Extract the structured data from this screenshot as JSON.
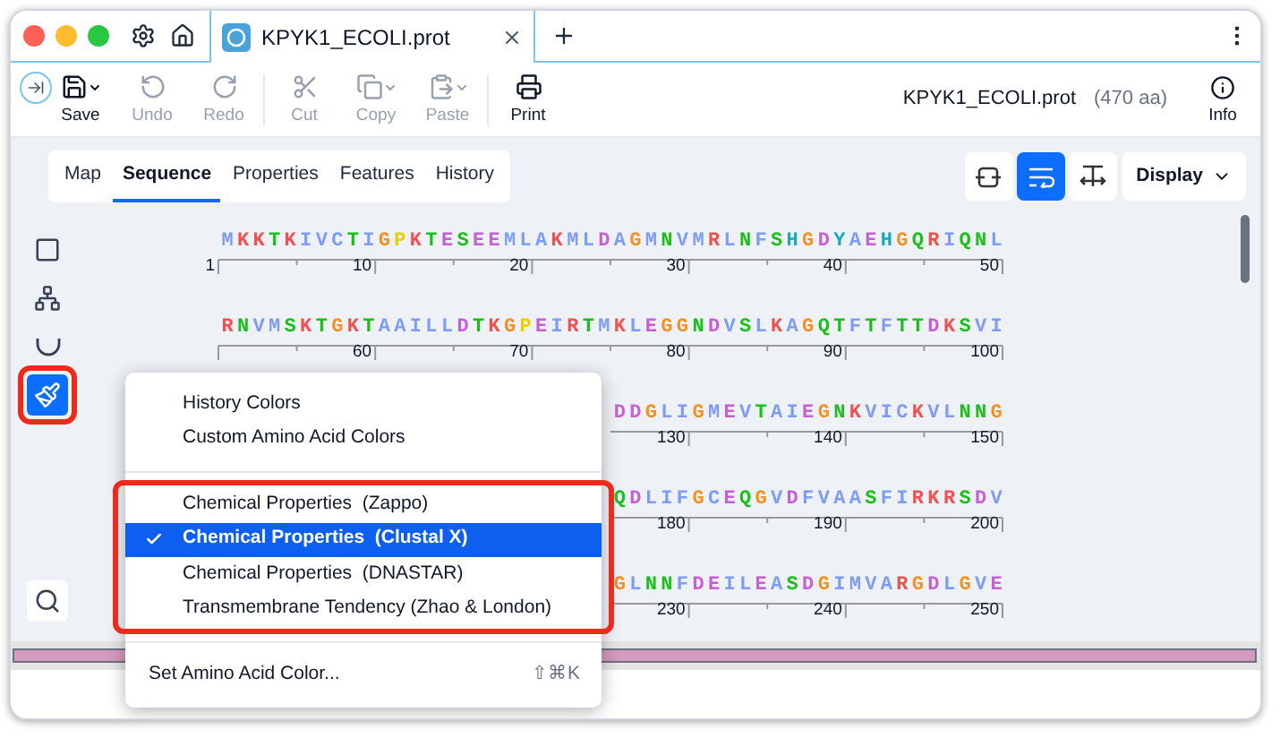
{
  "window": {
    "tab_title": "KPYK1_ECOLI.prot"
  },
  "toolbar": {
    "groups": [
      [
        {
          "label": "Save",
          "kind": "save",
          "disabled": false,
          "has_menu": true
        },
        {
          "label": "Undo",
          "kind": "undo",
          "disabled": true,
          "has_menu": false
        },
        {
          "label": "Redo",
          "kind": "redo",
          "disabled": true,
          "has_menu": false
        }
      ],
      [
        {
          "label": "Cut",
          "kind": "cut",
          "disabled": true,
          "has_menu": false
        },
        {
          "label": "Copy",
          "kind": "copy",
          "disabled": true,
          "has_menu": true
        },
        {
          "label": "Paste",
          "kind": "paste",
          "disabled": true,
          "has_menu": true
        }
      ],
      [
        {
          "label": "Print",
          "kind": "print",
          "disabled": false,
          "has_menu": false
        }
      ]
    ],
    "file_name": "KPYK1_ECOLI.prot",
    "length": "(470 aa)",
    "info": "Info"
  },
  "view_tabs": [
    {
      "label": "Map",
      "selected": false
    },
    {
      "label": "Sequence",
      "selected": true
    },
    {
      "label": "Properties",
      "selected": false
    },
    {
      "label": "Features",
      "selected": false
    },
    {
      "label": "History",
      "selected": false
    }
  ],
  "view_buttons": [
    {
      "kind": "collapse",
      "selected": false
    },
    {
      "kind": "wrap",
      "selected": true
    },
    {
      "kind": "fit",
      "selected": false
    }
  ],
  "display_menu": "Display",
  "tools": [
    {
      "kind": "rect",
      "selected": false,
      "highlighted": false
    },
    {
      "kind": "tree",
      "selected": false,
      "highlighted": false
    },
    {
      "kind": "cup",
      "selected": false,
      "highlighted": false
    },
    {
      "kind": "brush",
      "selected": true,
      "highlighted": true
    },
    {
      "kind": "search",
      "selected": false,
      "highlighted": false
    }
  ],
  "sequence_rows": [
    {
      "residues": "MKKTKIVCTIGPKTESEEMLAKMLDAGMNVMRLNFSHGDYAEHGQRIQNL",
      "ruler": [
        "1",
        "10",
        "20",
        "30",
        "40",
        "50"
      ]
    },
    {
      "residues": "RNVMSKTGKTAAILLDTKGPEIRTMKLEGGNDVSLKAGQTFTFTTDKSVI",
      "ruler": [
        "60",
        "70",
        "80",
        "90",
        "100"
      ]
    },
    {
      "residues": "DDGLIGMEVTAIEGNKVICKVLNNG",
      "ruler": [
        "130",
        "140",
        "150"
      ]
    },
    {
      "residues": "QDLIFGCEQGVDFVAASFIRKRSDV",
      "ruler": [
        "180",
        "190",
        "200"
      ]
    },
    {
      "residues": "GLNNFDEILEASDGIMVARGDLGVE",
      "ruler": [
        "230",
        "240",
        "250"
      ]
    }
  ],
  "color_menu": {
    "groups": [
      {
        "highlighted": false,
        "items": [
          {
            "label": "History Colors",
            "selected": false
          },
          {
            "label": "Custom Amino Acid Colors",
            "selected": false
          }
        ]
      },
      {
        "highlighted": true,
        "items": [
          {
            "label": "Chemical Properties  (Zappo)",
            "selected": false
          },
          {
            "label": "Chemical Properties  (Clustal X)",
            "selected": true
          },
          {
            "label": "Chemical Properties  (DNASTAR)",
            "selected": false
          },
          {
            "label": "Transmembrane Tendency (Zhao & London)",
            "selected": false
          }
        ]
      },
      {
        "highlighted": false,
        "items": [
          {
            "label": "Set Amino Acid Color...",
            "selected": false,
            "shortcut": "⇧⌘K"
          }
        ]
      }
    ]
  }
}
